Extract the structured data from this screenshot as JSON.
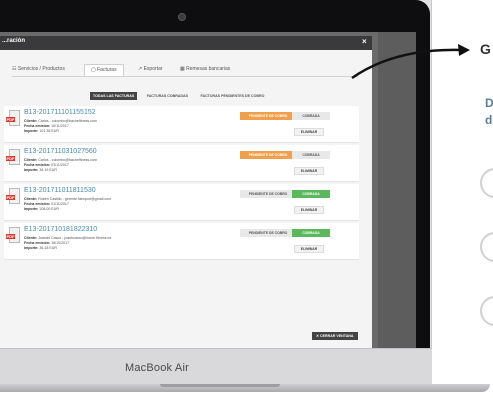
{
  "device": {
    "brand": "MacBook Air"
  },
  "modal": {
    "title": "...ración",
    "close_label": "×",
    "tabs": [
      {
        "label": "☷ Servicios / Productos"
      },
      {
        "label": "▢ Facturas"
      },
      {
        "label": "↗ Exportar"
      },
      {
        "label": "▦ Remesas bancarias"
      }
    ],
    "filters": [
      {
        "label": "TODAS LAS FACTURAS"
      },
      {
        "label": "FACTURAS COBRADAS"
      },
      {
        "label": "FACTURAS PENDIENTES DE COBRO"
      }
    ],
    "invoices": [
      {
        "number": "B13-201711101155152",
        "client": "Carlos - colombo@bachefitness.com",
        "date": "10/11/2017",
        "amount": "101.35 EUR",
        "status": "PENDIENTE DE COBRO",
        "action": "COBRADA",
        "delete": "ELIMINAR",
        "status_color": "#f0a04b",
        "action_color": "#e8e8e8"
      },
      {
        "number": "E13-201711031027560",
        "client": "Carlos - colombo@bachefitness.com",
        "date": "03/11/2017",
        "amount": "36.19 EUR",
        "status": "PENDIENTE DE COBRO",
        "action": "COBRADA",
        "delete": "ELIMINAR",
        "status_color": "#f0a04b",
        "action_color": "#e8e8e8"
      },
      {
        "number": "E13-201711011811530",
        "client": "Rubén Castillo - gerente.faenport@gmail.com",
        "date": "01/11/2017",
        "amount": "108.00 EUR",
        "status": "PENDIENTE DE COBRO",
        "action": "COBRADA",
        "delete": "ELIMINAR",
        "status_color": "#e8e8e8",
        "action_color": "#5cb85c"
      },
      {
        "number": "E13-201710181822310",
        "client": "Juanán Casco - juanbcasco@home.fitness.es",
        "date": "18/10/2017",
        "amount": "36.18 EUR",
        "status": "PENDIENTE DE COBRO",
        "action": "COBRADA",
        "delete": "ELIMINAR",
        "status_color": "#e8e8e8",
        "action_color": "#5cb85c"
      }
    ],
    "labels": {
      "client": "Cliente:",
      "date": "Fecha emisión:",
      "amount": "Importe:"
    },
    "close_window": "✕ CERRAR VENTANA"
  },
  "side": {
    "heading_initial": "G",
    "sub_line1": "D",
    "sub_line2": "d"
  }
}
